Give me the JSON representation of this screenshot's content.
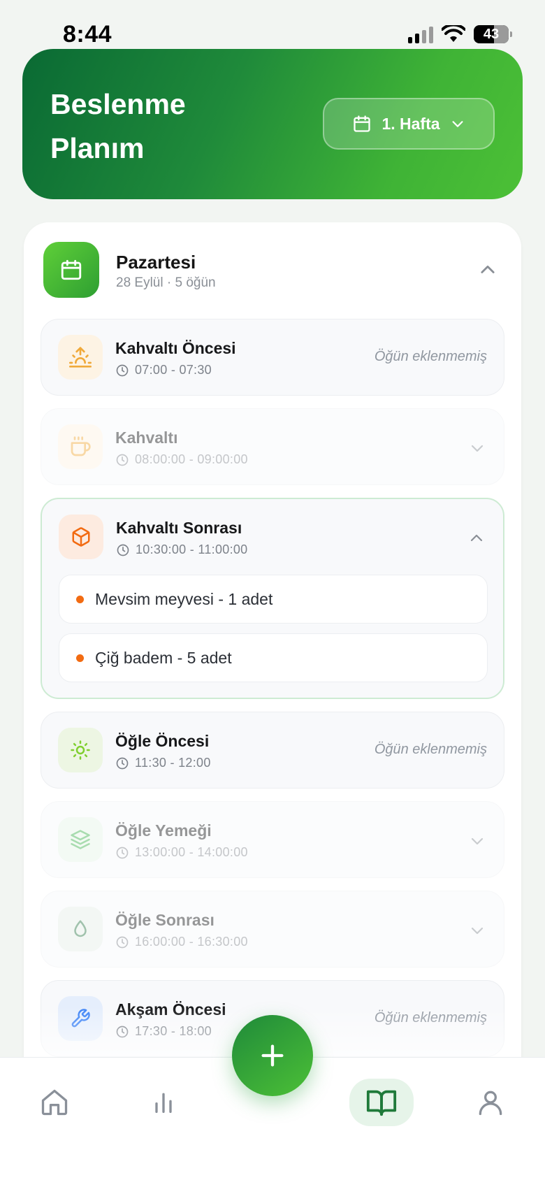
{
  "status_bar": {
    "time": "8:44",
    "battery": "43"
  },
  "header": {
    "title": "Beslenme Planım",
    "week_label": "1. Hafta"
  },
  "day": {
    "name": "Pazartesi",
    "subtitle": "28 Eylül · 5 öğün"
  },
  "meals": [
    {
      "title": "Kahvaltı Öncesi",
      "time": "07:00 - 07:30",
      "status": "Öğün eklenmemiş",
      "icon": "sunrise-icon",
      "icon_color": "#f0a93a",
      "icon_bg": "#fdf3e4"
    },
    {
      "title": "Kahvaltı",
      "time": "08:00:00 - 09:00:00",
      "icon": "coffee-icon",
      "icon_color": "#f0a93a",
      "icon_bg": "#fdf3e4"
    },
    {
      "title": "Kahvaltı Sonrası",
      "time": "10:30:00 - 11:00:00",
      "icon": "box-icon",
      "icon_color": "#f26b12",
      "icon_bg": "#fdebe0",
      "foods": [
        "Mevsim meyvesi - 1 adet",
        "Çiğ badem - 5 adet"
      ]
    },
    {
      "title": "Öğle Öncesi",
      "time": "11:30 - 12:00",
      "status": "Öğün eklenmemiş",
      "icon": "sun-icon",
      "icon_color": "#7fcf2f",
      "icon_bg": "#edf6e3"
    },
    {
      "title": "Öğle Yemeği",
      "time": "13:00:00 - 14:00:00",
      "icon": "layers-icon",
      "icon_color": "#3fb34f",
      "icon_bg": "#e5f4e7"
    },
    {
      "title": "Öğle Sonrası",
      "time": "16:00:00 - 16:30:00",
      "icon": "droplet-icon",
      "icon_color": "#2f7a4a",
      "icon_bg": "#e5efe8"
    },
    {
      "title": "Akşam Öncesi",
      "time": "17:30 - 18:00",
      "status": "Öğün eklenmemiş",
      "icon": "wrench-icon",
      "icon_color": "#3b82f6",
      "icon_bg": "#e5eefc"
    }
  ],
  "nav": {
    "items": [
      "home-icon",
      "stats-icon",
      "add-icon",
      "book-icon",
      "profile-icon"
    ],
    "active": "book-icon",
    "accent": "#1f7a3a"
  }
}
